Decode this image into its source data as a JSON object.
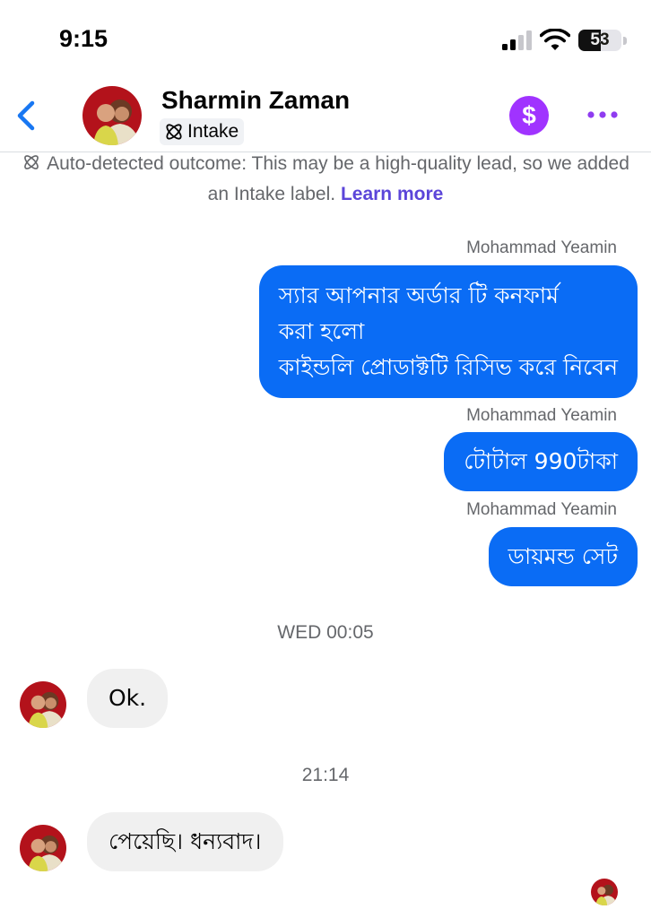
{
  "status_bar": {
    "time": "9:15",
    "battery_level": "53",
    "battery_fraction": 0.53,
    "signal_icon": "cellular-signal-icon",
    "wifi_icon": "wifi-icon"
  },
  "header": {
    "back_icon": "chevron-left-icon",
    "contact_name": "Sharmin Zaman",
    "label": "Intake",
    "label_icon": "atom-icon",
    "payment_icon_text": "$",
    "more_icon": "more-horizontal-icon"
  },
  "notice": {
    "text": "Auto-detected outcome: This may be a high-quality lead, so we added an Intake label.",
    "link": "Learn more"
  },
  "messages": [
    {
      "direction": "outgoing",
      "sender": "Mohammad Yeamin",
      "lines": [
        "স্যার আপনার অর্ডার টি কনফার্ম",
        "করা হলো",
        "কাইন্ডলি প্রোডাক্টটি রিসিভ করে নিবেন"
      ]
    },
    {
      "direction": "outgoing",
      "sender": "Mohammad Yeamin",
      "lines": [
        "টোটাল 990টাকা"
      ]
    },
    {
      "direction": "outgoing",
      "sender": "Mohammad Yeamin",
      "lines": [
        "ডায়মন্ড সেট"
      ]
    },
    {
      "direction": "timestamp",
      "text": "WED 00:05"
    },
    {
      "direction": "incoming",
      "text": "Ok."
    },
    {
      "direction": "timestamp",
      "text": "21:14"
    },
    {
      "direction": "incoming",
      "text": "পেয়েছি। ধন্যবাদ।"
    }
  ],
  "colors": {
    "outgoing_bubble": "#0a6cf5",
    "incoming_bubble": "#f0f0f0",
    "accent": "#1877f2",
    "payment": "#a033ff",
    "link": "#5b45d9"
  }
}
